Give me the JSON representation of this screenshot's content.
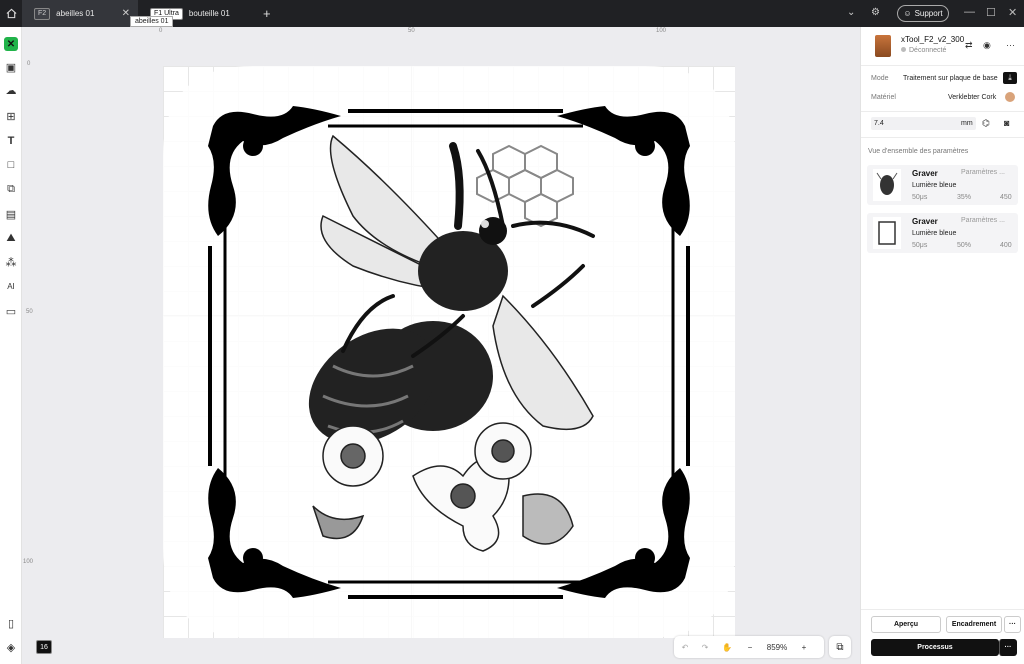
{
  "tabs": [
    {
      "badge": "F2",
      "label": "abeilles 01"
    },
    {
      "badge": "F1 Ultra",
      "label": "bouteille 01"
    }
  ],
  "tooltip": "abeilles 01",
  "titlebar": {
    "support_label": "Support"
  },
  "ruler": {
    "top": [
      "0",
      "50",
      "100"
    ],
    "left": [
      "0",
      "50",
      "100"
    ]
  },
  "zoom": {
    "value": "859%"
  },
  "bottom_badge": "16",
  "device": {
    "name": "xTool_F2_v2_300",
    "status": "Déconnecté"
  },
  "mode": {
    "label": "Mode",
    "value": "Traitement sur plaque de base"
  },
  "material": {
    "label": "Matériel",
    "value": "Verklebter Cork"
  },
  "thickness": {
    "value": "7.4",
    "unit": "mm"
  },
  "overview_title": "Vue d'ensemble des paramètres",
  "layers": [
    {
      "name": "Graver",
      "params": "Paramètres ...",
      "laser": "Lumière bleue",
      "v1": "50μs",
      "v2": "35%",
      "v3": "450"
    },
    {
      "name": "Graver",
      "params": "Paramètres ...",
      "laser": "Lumière bleue",
      "v1": "50μs",
      "v2": "50%",
      "v3": "400"
    }
  ],
  "buttons": {
    "preview": "Aperçu",
    "frame": "Encadrement",
    "more": "···",
    "process": "Processus"
  },
  "colors": {
    "brand": "#21b34a",
    "titlebar": "#202124",
    "material_swatch": "#d9a37a"
  }
}
